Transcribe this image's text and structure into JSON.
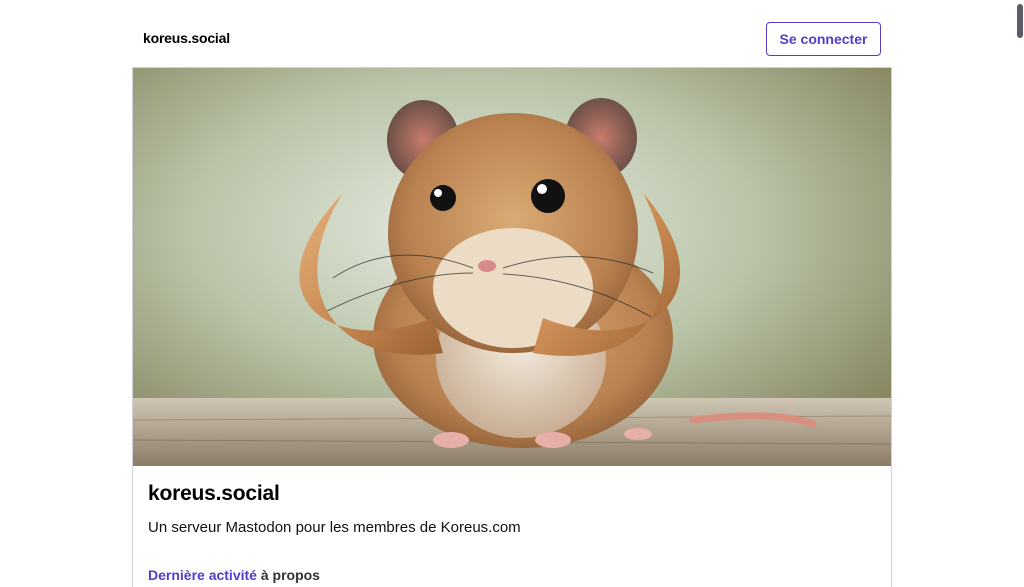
{
  "header": {
    "brand": "koreus.social",
    "login_label": "Se connecter"
  },
  "server": {
    "name": "koreus.social",
    "description": "Un serveur Mastodon pour les membres de Koreus.com",
    "activity_link": "Dernière activité",
    "activity_rest": " à propos"
  },
  "hero": {
    "subject": "hamster-with-mammoth-tusks"
  },
  "colors": {
    "accent": "#563acc",
    "border": "#d0d0d8"
  }
}
